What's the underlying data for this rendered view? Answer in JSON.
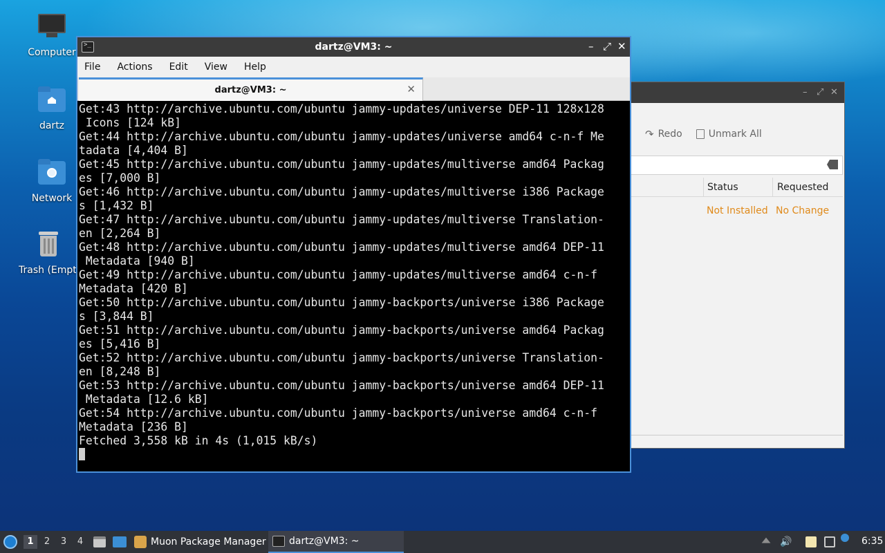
{
  "desktop": {
    "icons": [
      {
        "label": "Computer"
      },
      {
        "label": "dartz"
      },
      {
        "label": "Network"
      },
      {
        "label": "Trash (Empty)"
      }
    ]
  },
  "muon": {
    "toolbar": {
      "redo": "Redo",
      "unmark_all": "Unmark All"
    },
    "columns": {
      "status": "Status",
      "requested": "Requested"
    },
    "row": {
      "status": "Not Installed",
      "requested": "No Change"
    },
    "status_color": "#e08a1a"
  },
  "terminal": {
    "title": "dartz@VM3: ~",
    "menu": [
      "File",
      "Actions",
      "Edit",
      "View",
      "Help"
    ],
    "tab_label": "dartz@VM3: ~",
    "output": "Get:43 http://archive.ubuntu.com/ubuntu jammy-updates/universe DEP-11 128x128\n Icons [124 kB]\nGet:44 http://archive.ubuntu.com/ubuntu jammy-updates/universe amd64 c-n-f Me\ntadata [4,404 B]\nGet:45 http://archive.ubuntu.com/ubuntu jammy-updates/multiverse amd64 Packag\nes [7,000 B]\nGet:46 http://archive.ubuntu.com/ubuntu jammy-updates/multiverse i386 Package\ns [1,432 B]\nGet:47 http://archive.ubuntu.com/ubuntu jammy-updates/multiverse Translation-\nen [2,264 B]\nGet:48 http://archive.ubuntu.com/ubuntu jammy-updates/multiverse amd64 DEP-11\n Metadata [940 B]\nGet:49 http://archive.ubuntu.com/ubuntu jammy-updates/multiverse amd64 c-n-f\nMetadata [420 B]\nGet:50 http://archive.ubuntu.com/ubuntu jammy-backports/universe i386 Package\ns [3,844 B]\nGet:51 http://archive.ubuntu.com/ubuntu jammy-backports/universe amd64 Packag\nes [5,416 B]\nGet:52 http://archive.ubuntu.com/ubuntu jammy-backports/universe Translation-\nen [8,248 B]\nGet:53 http://archive.ubuntu.com/ubuntu jammy-backports/universe amd64 DEP-11\n Metadata [12.6 kB]\nGet:54 http://archive.ubuntu.com/ubuntu jammy-backports/universe amd64 c-n-f\nMetadata [236 B]\nFetched 3,558 kB in 4s (1,015 kB/s)\n"
  },
  "taskbar": {
    "workspaces": [
      "1",
      "2",
      "3",
      "4"
    ],
    "tasks": [
      {
        "label": "Muon Package Manager"
      },
      {
        "label": "dartz@VM3: ~"
      }
    ],
    "clock": "6:35",
    "accent": "#4a90d9"
  }
}
